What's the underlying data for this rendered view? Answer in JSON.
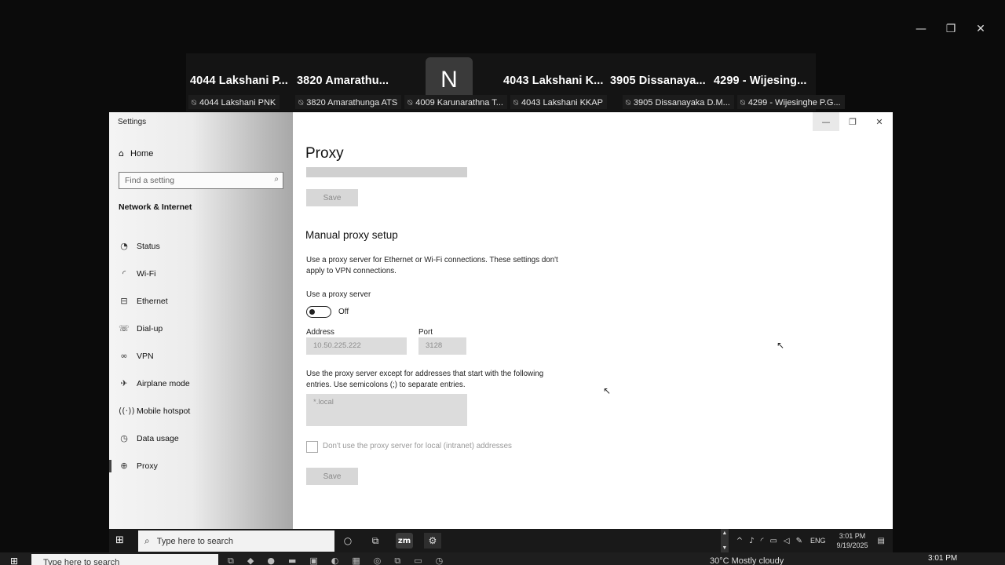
{
  "outer_window": {
    "controls": [
      "—",
      "❐",
      "✕"
    ]
  },
  "gallery": {
    "names": [
      "4044 Lakshani P...",
      "3820 Amarathu...",
      "4043 Lakshani K...",
      "3905 Dissanaya...",
      "4299 - Wijesing..."
    ],
    "avatar_letter": "N",
    "tags": [
      "4044 Lakshani PNK",
      "3820 Amarathunga ATS",
      "4009 Karunarathna T...",
      "4043 Lakshani KKAP",
      "3905 Dissanayaka D.M...",
      "4299 - Wijesinghe P.G..."
    ]
  },
  "settings": {
    "window_title": "Settings",
    "controls": [
      "—",
      "❐",
      "✕"
    ],
    "sidebar": {
      "home": "Home",
      "search_placeholder": "Find a setting",
      "section": "Network & Internet",
      "items": [
        {
          "label": "Status",
          "icon": "status-icon"
        },
        {
          "label": "Wi-Fi",
          "icon": "wifi-icon"
        },
        {
          "label": "Ethernet",
          "icon": "ethernet-icon"
        },
        {
          "label": "Dial-up",
          "icon": "dialup-icon"
        },
        {
          "label": "VPN",
          "icon": "vpn-icon"
        },
        {
          "label": "Airplane mode",
          "icon": "airplane-icon"
        },
        {
          "label": "Mobile hotspot",
          "icon": "hotspot-icon"
        },
        {
          "label": "Data usage",
          "icon": "data-usage-icon"
        },
        {
          "label": "Proxy",
          "icon": "globe-icon"
        }
      ]
    },
    "main": {
      "title": "Proxy",
      "save_top": "Save",
      "manual_heading": "Manual proxy setup",
      "manual_desc": "Use a proxy server for Ethernet or Wi-Fi connections. These settings don't apply to VPN connections.",
      "use_proxy_label": "Use a proxy server",
      "toggle_state": "Off",
      "address_label": "Address",
      "address_value": "10.50.225.222",
      "port_label": "Port",
      "port_value": "3128",
      "exceptions_desc": "Use the proxy server except for addresses that start with the following entries. Use semicolons (;) to separate entries.",
      "exceptions_value": "*.local",
      "local_checkbox_label": "Don't use the proxy server for local (intranet) addresses",
      "save_bottom": "Save"
    }
  },
  "taskbar": {
    "search_placeholder": "Type here to search",
    "zoom_label": "zm",
    "lang": "ENG",
    "time": "3:01 PM",
    "date": "9/19/2025"
  },
  "host_taskbar": {
    "search_placeholder": "Type here to search",
    "weather": "30°C  Mostly cloudy",
    "time": "3:01 PM"
  }
}
